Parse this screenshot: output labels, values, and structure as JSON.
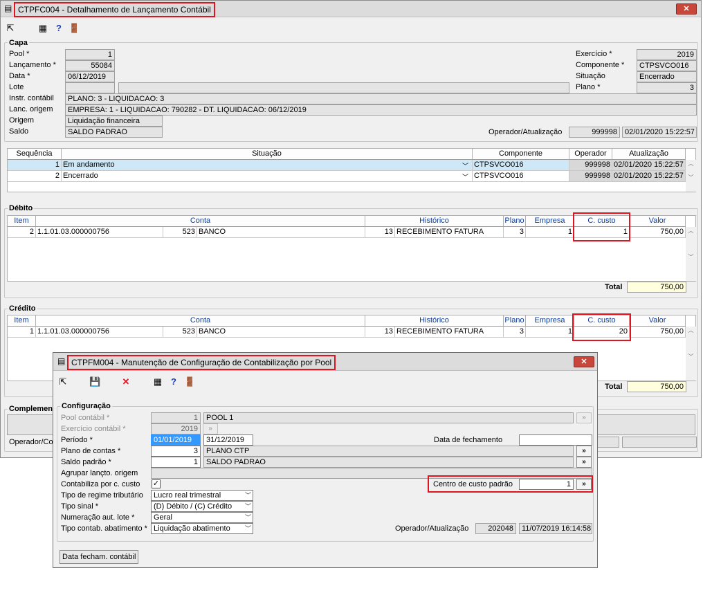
{
  "main": {
    "title": "CTPFC004 - Detalhamento de Lançamento Contábil",
    "close_label": "✕",
    "capa": {
      "title": "Capa",
      "pool_label": "Pool *",
      "pool_value": "1",
      "lancamento_label": "Lançamento *",
      "lancamento_value": "55084",
      "data_label": "Data *",
      "data_value": "06/12/2019",
      "lote_label": "Lote",
      "instr_label": "Instr. contábil",
      "instr_value": "PLANO: 3 - LIQUIDACAO: 3",
      "lanc_origem_label": "Lanc. origem",
      "lanc_origem_value": "EMPRESA: 1 - LIQUIDACAO: 790282 - DT. LIQUIDACAO: 06/12/2019",
      "origem_label": "Origem",
      "origem_value": "Liquidação financeira",
      "saldo_label": "Saldo",
      "saldo_value": "SALDO PADRAO",
      "exercicio_label": "Exercício *",
      "exercicio_value": "2019",
      "componente_label": "Componente *",
      "componente_value": "CTPSVCO016",
      "situacao_label": "Situação",
      "situacao_value": "Encerrado",
      "plano_label": "Plano *",
      "plano_value": "3",
      "operador_label": "Operador/Atualização",
      "operador_value": "999998",
      "atualizacao_value": "02/01/2020 15:22:57"
    },
    "situacao_grid": {
      "headers": [
        "Sequência",
        "Situação",
        "Componente",
        "Operador",
        "Atualização"
      ],
      "rows": [
        [
          "1",
          "Em andamento",
          "CTPSVCO016",
          "999998",
          "02/01/2020 15:22:57"
        ],
        [
          "2",
          "Encerrado",
          "CTPSVCO016",
          "999998",
          "02/01/2020 15:22:57"
        ]
      ]
    },
    "debito": {
      "title": "Débito",
      "headers": [
        "Item",
        "Conta",
        "Histórico",
        "Plano",
        "Empresa",
        "C. custo",
        "Valor"
      ],
      "row": [
        "2",
        "1.1.01.03.000000756",
        "523",
        "BANCO",
        "13",
        "RECEBIMENTO FATURA",
        "3",
        "1",
        "1",
        "750,00"
      ],
      "total_label": "Total",
      "total_value": "750,00"
    },
    "credito": {
      "title": "Crédito",
      "headers": [
        "Item",
        "Conta",
        "Histórico",
        "Plano",
        "Empresa",
        "C. custo",
        "Valor"
      ],
      "row": [
        "1",
        "1.1.01.03.000000756",
        "523",
        "BANCO",
        "13",
        "RECEBIMENTO FATURA",
        "3",
        "1",
        "20",
        "750,00"
      ],
      "total_label": "Total",
      "total_value": "750,00"
    },
    "complemento": {
      "title": "Complemento",
      "operador_label": "Operador/Co"
    }
  },
  "dialog": {
    "title": "CTPFM004 - Manutenção de Configuração de Contabilização por Pool",
    "close_label": "✕",
    "config_title": "Configuração",
    "pool_label": "Pool contábil *",
    "pool_value": "1",
    "pool_name": "POOL 1",
    "exercicio_label": "Exercício contábil *",
    "exercicio_value": "2019",
    "periodo_label": "Período *",
    "periodo_start": "01/01/2019",
    "periodo_end": "31/12/2019",
    "data_fechamento_label": "Data de fechamento",
    "plano_label": "Plano de contas *",
    "plano_value": "3",
    "plano_name": "PLANO CTP",
    "saldo_label": "Saldo padrão *",
    "saldo_value": "1",
    "saldo_name": "SALDO PADRAO",
    "agrupar_label": "Agrupar lançto. origem",
    "contabiliza_label": "Contabiliza por c. custo",
    "contabiliza_check": "✓",
    "centro_label": "Centro de custo padrão",
    "centro_value": "1",
    "regime_label": "Tipo de regime tributário",
    "regime_value": "Lucro real trimestral",
    "sinal_label": "Tipo sinal *",
    "sinal_value": "(D) Débito / (C) Crédito",
    "numeracao_label": "Numeração aut. lote *",
    "numeracao_value": "Geral",
    "abatimento_label": "Tipo contab. abatimento *",
    "abatimento_value": "Liquidação abatimento",
    "operador_label": "Operador/Atualização",
    "operador_value": "202048",
    "atualizacao_value": "11/07/2019 16:14:58",
    "fecham_button": "Data fecham. contábil",
    "lookup_label": "»"
  }
}
